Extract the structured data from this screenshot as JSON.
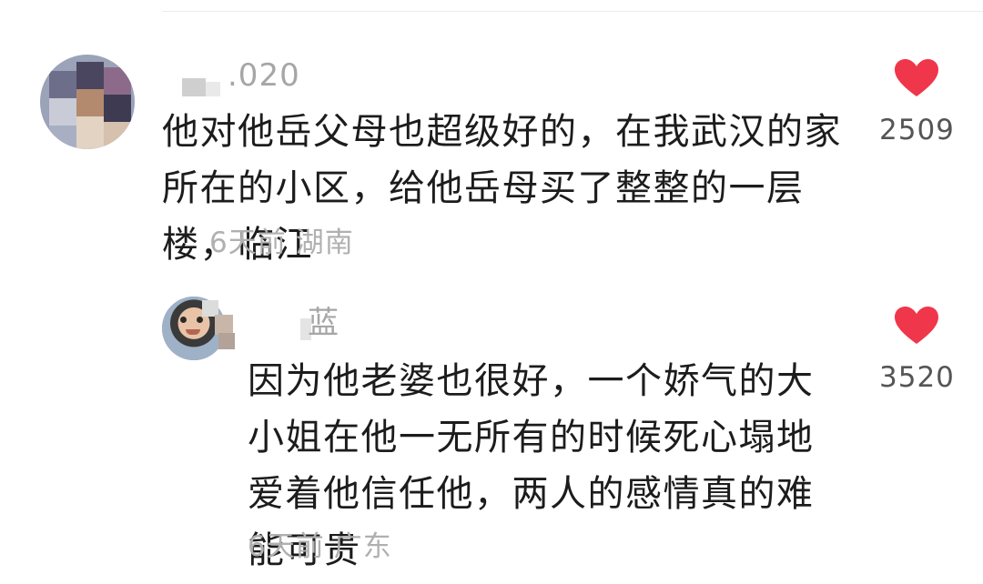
{
  "comments": [
    {
      "username": ".020",
      "text": "他对他岳父母也超级好的，在我武汉的家所在的小区，给他岳母买了整整的一层楼，临江",
      "time": "6天前",
      "location": "湖南",
      "likes": "2509"
    }
  ],
  "reply": {
    "username": "蓝",
    "text": "因为他老婆也很好，一个娇气的大小姐在他一无所有的时候死心塌地爱着他信任他，两人的感情真的难能可贵",
    "time": "6天前",
    "location": "广东",
    "likes": "3520"
  },
  "colors": {
    "like": "#f0364a",
    "text": "#1c1c1c",
    "meta": "#b0b0b0"
  }
}
